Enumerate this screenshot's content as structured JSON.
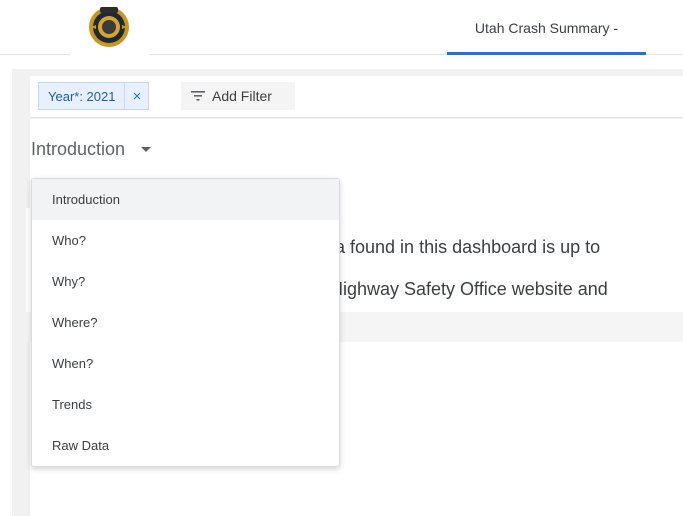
{
  "header": {
    "logo_icon": "shield-seal-icon",
    "tab_label": "Utah Crash Summary -",
    "tab_accent": "#1a73e8"
  },
  "filters": {
    "chip_label": "Year*: 2021",
    "chip_close": "×",
    "add_filter_label": "Add Filter",
    "add_filter_icon": "filter-icon"
  },
  "page_selector": {
    "current": "Introduction",
    "caret_icon": "caret-down-icon"
  },
  "content": {
    "line1": "ta found in this dashboard is up to",
    "line2": "Highway Safety Office website and"
  },
  "dropdown": {
    "items": [
      {
        "label": "Introduction",
        "active": true
      },
      {
        "label": "Who?"
      },
      {
        "label": "Why?"
      },
      {
        "label": "Where?"
      },
      {
        "label": "When?"
      },
      {
        "label": "Trends"
      },
      {
        "label": "Raw Data"
      }
    ]
  }
}
